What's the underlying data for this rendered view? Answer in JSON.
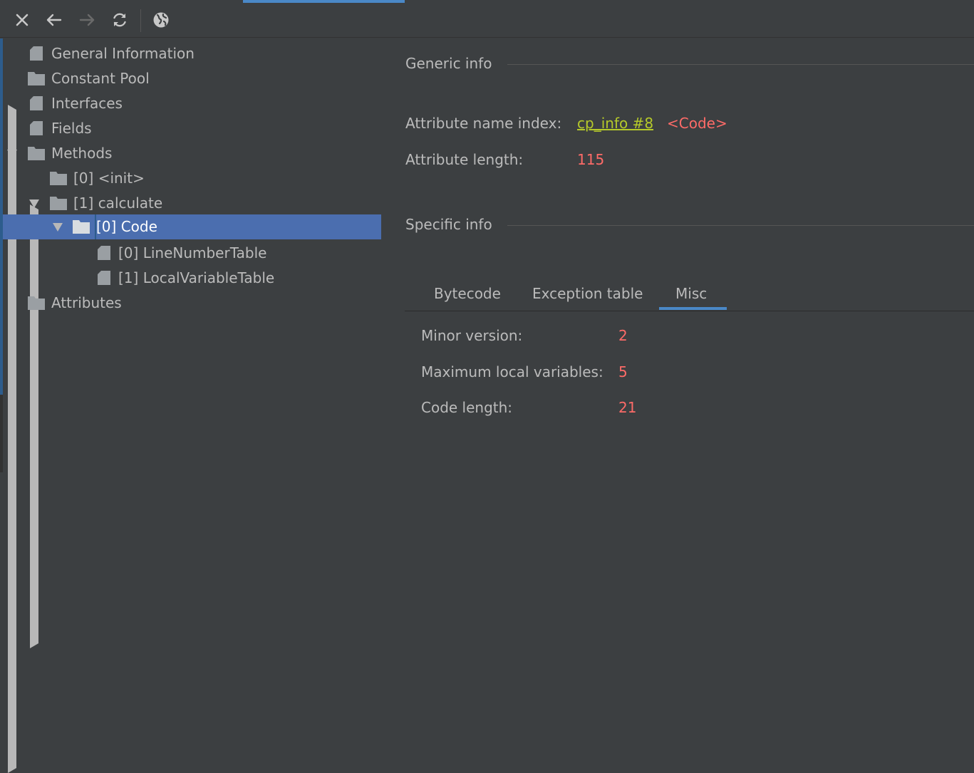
{
  "toolbar": {
    "close_icon": "close-icon",
    "back_icon": "arrow-left-icon",
    "forward_icon": "arrow-right-icon",
    "refresh_icon": "refresh-icon",
    "web_icon": "globe-icon"
  },
  "tree": {
    "items": [
      {
        "label": "General Information",
        "icon": "file-icon"
      },
      {
        "label": "Constant Pool",
        "icon": "folder-icon"
      },
      {
        "label": "Interfaces",
        "icon": "file-icon"
      },
      {
        "label": "Fields",
        "icon": "file-icon"
      },
      {
        "label": "Methods",
        "icon": "folder-icon"
      },
      {
        "label": "[0] <init>",
        "icon": "folder-icon"
      },
      {
        "label": "[1] calculate",
        "icon": "folder-icon"
      },
      {
        "label": "[0] Code",
        "icon": "folder-icon"
      },
      {
        "label": "[0] LineNumberTable",
        "icon": "file-icon"
      },
      {
        "label": "[1] LocalVariableTable",
        "icon": "file-icon"
      },
      {
        "label": "Attributes",
        "icon": "folder-icon"
      }
    ]
  },
  "generic": {
    "title": "Generic info",
    "name_index_label": "Attribute name index:",
    "name_index_link": "cp_info #8",
    "name_index_value": "<Code>",
    "length_label": "Attribute length:",
    "length_value": "115"
  },
  "specific": {
    "title": "Specific info",
    "tabs": [
      {
        "label": "Bytecode"
      },
      {
        "label": "Exception table"
      },
      {
        "label": "Misc"
      }
    ],
    "selected_tab": "Misc",
    "minor_label": "Minor version:",
    "minor_value": "2",
    "maxlocals_label": "Maximum local variables:",
    "maxlocals_value": "5",
    "codelen_label": "Code length:",
    "codelen_value": "21"
  },
  "colors": {
    "background": "#3c3f41",
    "selection": "#4b6eaf",
    "accent": "#4a88c7",
    "value_red": "#ff6b68",
    "link_green": "#b5c92a"
  }
}
